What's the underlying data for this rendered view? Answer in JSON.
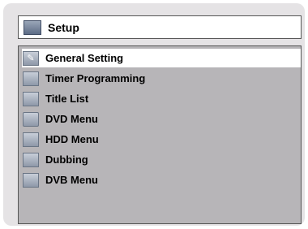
{
  "header": {
    "title": "Setup",
    "icon": "setup-icon"
  },
  "menu": {
    "items": [
      {
        "label": "General Setting",
        "icon": "wrench-icon",
        "selected": true
      },
      {
        "label": "Timer Programming",
        "icon": "timer-grid-icon",
        "selected": false
      },
      {
        "label": "Title List",
        "icon": "list-icon",
        "selected": false
      },
      {
        "label": "DVD Menu",
        "icon": "disc-icon",
        "selected": false
      },
      {
        "label": "HDD Menu",
        "icon": "hdd-icon",
        "selected": false
      },
      {
        "label": "Dubbing",
        "icon": "dubbing-icon",
        "selected": false
      },
      {
        "label": "DVB Menu",
        "icon": "dvb-icon",
        "selected": false
      }
    ]
  },
  "colors": {
    "background": "#e5e3e5",
    "panel": "#b7b5b8",
    "highlight": "#ffffff"
  }
}
